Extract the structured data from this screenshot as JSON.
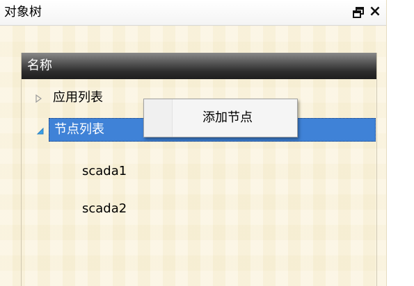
{
  "window": {
    "title": "对象树"
  },
  "tree": {
    "column_header": "名称",
    "nodes": [
      {
        "label": "应用列表",
        "expanded": false
      },
      {
        "label": "节点列表",
        "expanded": true,
        "selected": true,
        "children": [
          {
            "label": "scada1"
          },
          {
            "label": "scada2"
          }
        ]
      }
    ]
  },
  "context_menu": {
    "items": [
      {
        "label": "添加节点"
      }
    ]
  },
  "colors": {
    "panel_bg": "#faf3dc",
    "selection": "#3f82d7",
    "header_bg": "#2e2e2e"
  },
  "icons": {
    "float": "float-window-icon",
    "close": "close-icon",
    "collapsed": "triangle-right-icon",
    "expanded": "triangle-down-right-icon"
  }
}
